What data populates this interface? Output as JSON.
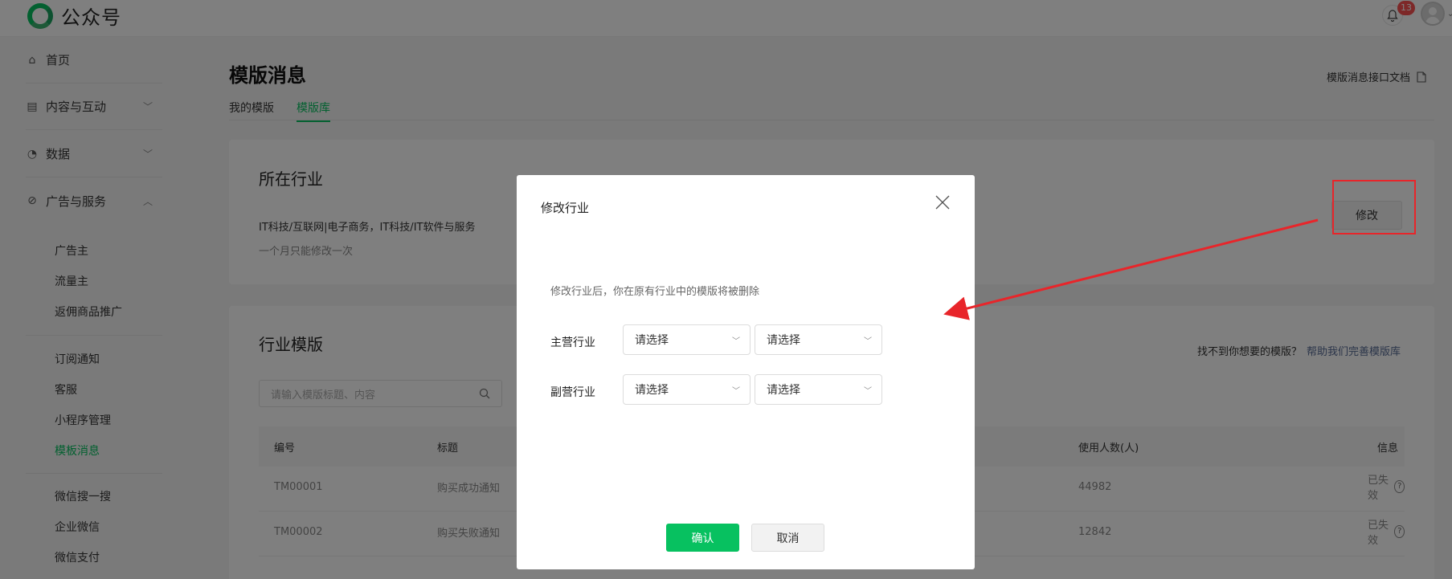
{
  "topbar": {
    "app_name": "公众号",
    "notification_count": "13"
  },
  "sidebar": {
    "main_items": [
      {
        "label": "首页",
        "icon": "home-icon"
      },
      {
        "label": "内容与互动",
        "icon": "document-icon",
        "expanded": false
      },
      {
        "label": "数据",
        "icon": "pie-chart-icon",
        "expanded": false
      },
      {
        "label": "广告与服务",
        "icon": "compass-icon",
        "expanded": true
      }
    ],
    "group1": [
      "广告主",
      "流量主",
      "返佣商品推广"
    ],
    "group2": [
      "订阅通知",
      "客服",
      "小程序管理",
      "模板消息"
    ],
    "group3": [
      "微信搜一搜",
      "企业微信",
      "微信支付"
    ],
    "active_item": "模板消息"
  },
  "main": {
    "title": "模版消息",
    "doc_link": "模版消息接口文档",
    "tabs": [
      {
        "label": "我的模版",
        "active": false
      },
      {
        "label": "模版库",
        "active": true
      }
    ],
    "industry": {
      "title": "所在行业",
      "value": "IT科技/互联网|电子商务，IT科技/IT软件与服务",
      "note": "一个月只能修改一次",
      "modify_button": "修改"
    },
    "templates": {
      "title": "行业模版",
      "hint": "找不到你想要的模版？",
      "hint_link": "帮助我们完善模版库",
      "search_placeholder": "请输入模版标题、内容",
      "columns": [
        "编号",
        "标题",
        "使用人数(人)",
        "信息"
      ],
      "rows": [
        {
          "id": "TM00001",
          "title": "购买成功通知",
          "users": "44982",
          "status": "已失效"
        },
        {
          "id": "TM00002",
          "title": "购买失败通知",
          "users": "12842",
          "status": "已失效"
        }
      ]
    }
  },
  "modal": {
    "title": "修改行业",
    "note": "修改行业后，你在原有行业中的模版将被删除",
    "primary_label": "主营行业",
    "secondary_label": "副营行业",
    "select_placeholder": "请选择",
    "confirm": "确认",
    "cancel": "取消"
  },
  "colors": {
    "accent": "#07c160",
    "annotation": "#e8252a",
    "link": "#576b95"
  }
}
